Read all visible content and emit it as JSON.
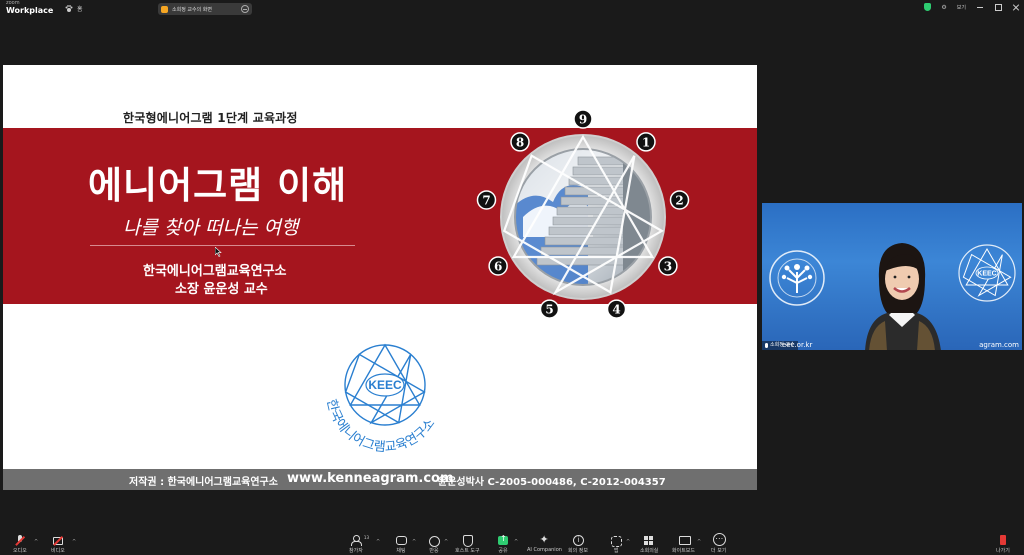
{
  "app": {
    "brand_small": "zoom",
    "brand_name": "Workplace",
    "home_label": "홈",
    "share_pill_text": "소희정 교수의 화면",
    "view_label": "보기",
    "share_color": "#f5a623",
    "secure_color": "#2ecc71"
  },
  "slide": {
    "course": "한국형에니어그램 1단계 교육과정",
    "title": "에니어그램 이해",
    "subtitle": "나를 찾아 떠나는 여행",
    "institute": "한국에니어그램교육연구소",
    "presenter": "소장 윤운성 교수",
    "enneagram_numbers": [
      "9",
      "1",
      "2",
      "3",
      "4",
      "5",
      "6",
      "7",
      "8"
    ],
    "logo_text": "KEEC",
    "logo_ring_text": "한국에니어그램교육연구소",
    "footer_copyright": "저작권 : 한국에니어그램교육연구소",
    "footer_url": "www.kenneagram.com",
    "footer_reg": "윤운성박사 C-2005-000486, C-2012-004357",
    "band_color": "#a5151e",
    "footer_color": "#6f6f6f"
  },
  "video": {
    "name_tag": "소희정 교수",
    "domain_left": "eec.or.kr",
    "domain_right": "agram.com",
    "watermark_text": "KEEC"
  },
  "toolbar": {
    "audio": "오디오",
    "video": "비디오",
    "participants": "참가자",
    "participants_count": "13",
    "chat": "채팅",
    "react": "반응",
    "host_tools": "호스트 도구",
    "share": "공유",
    "ai": "AI Companion",
    "info": "회의 정보",
    "apps": "앱",
    "layout": "소회의실",
    "whiteboard": "화이트보드",
    "more": "더 보기",
    "leave": "나가기"
  }
}
